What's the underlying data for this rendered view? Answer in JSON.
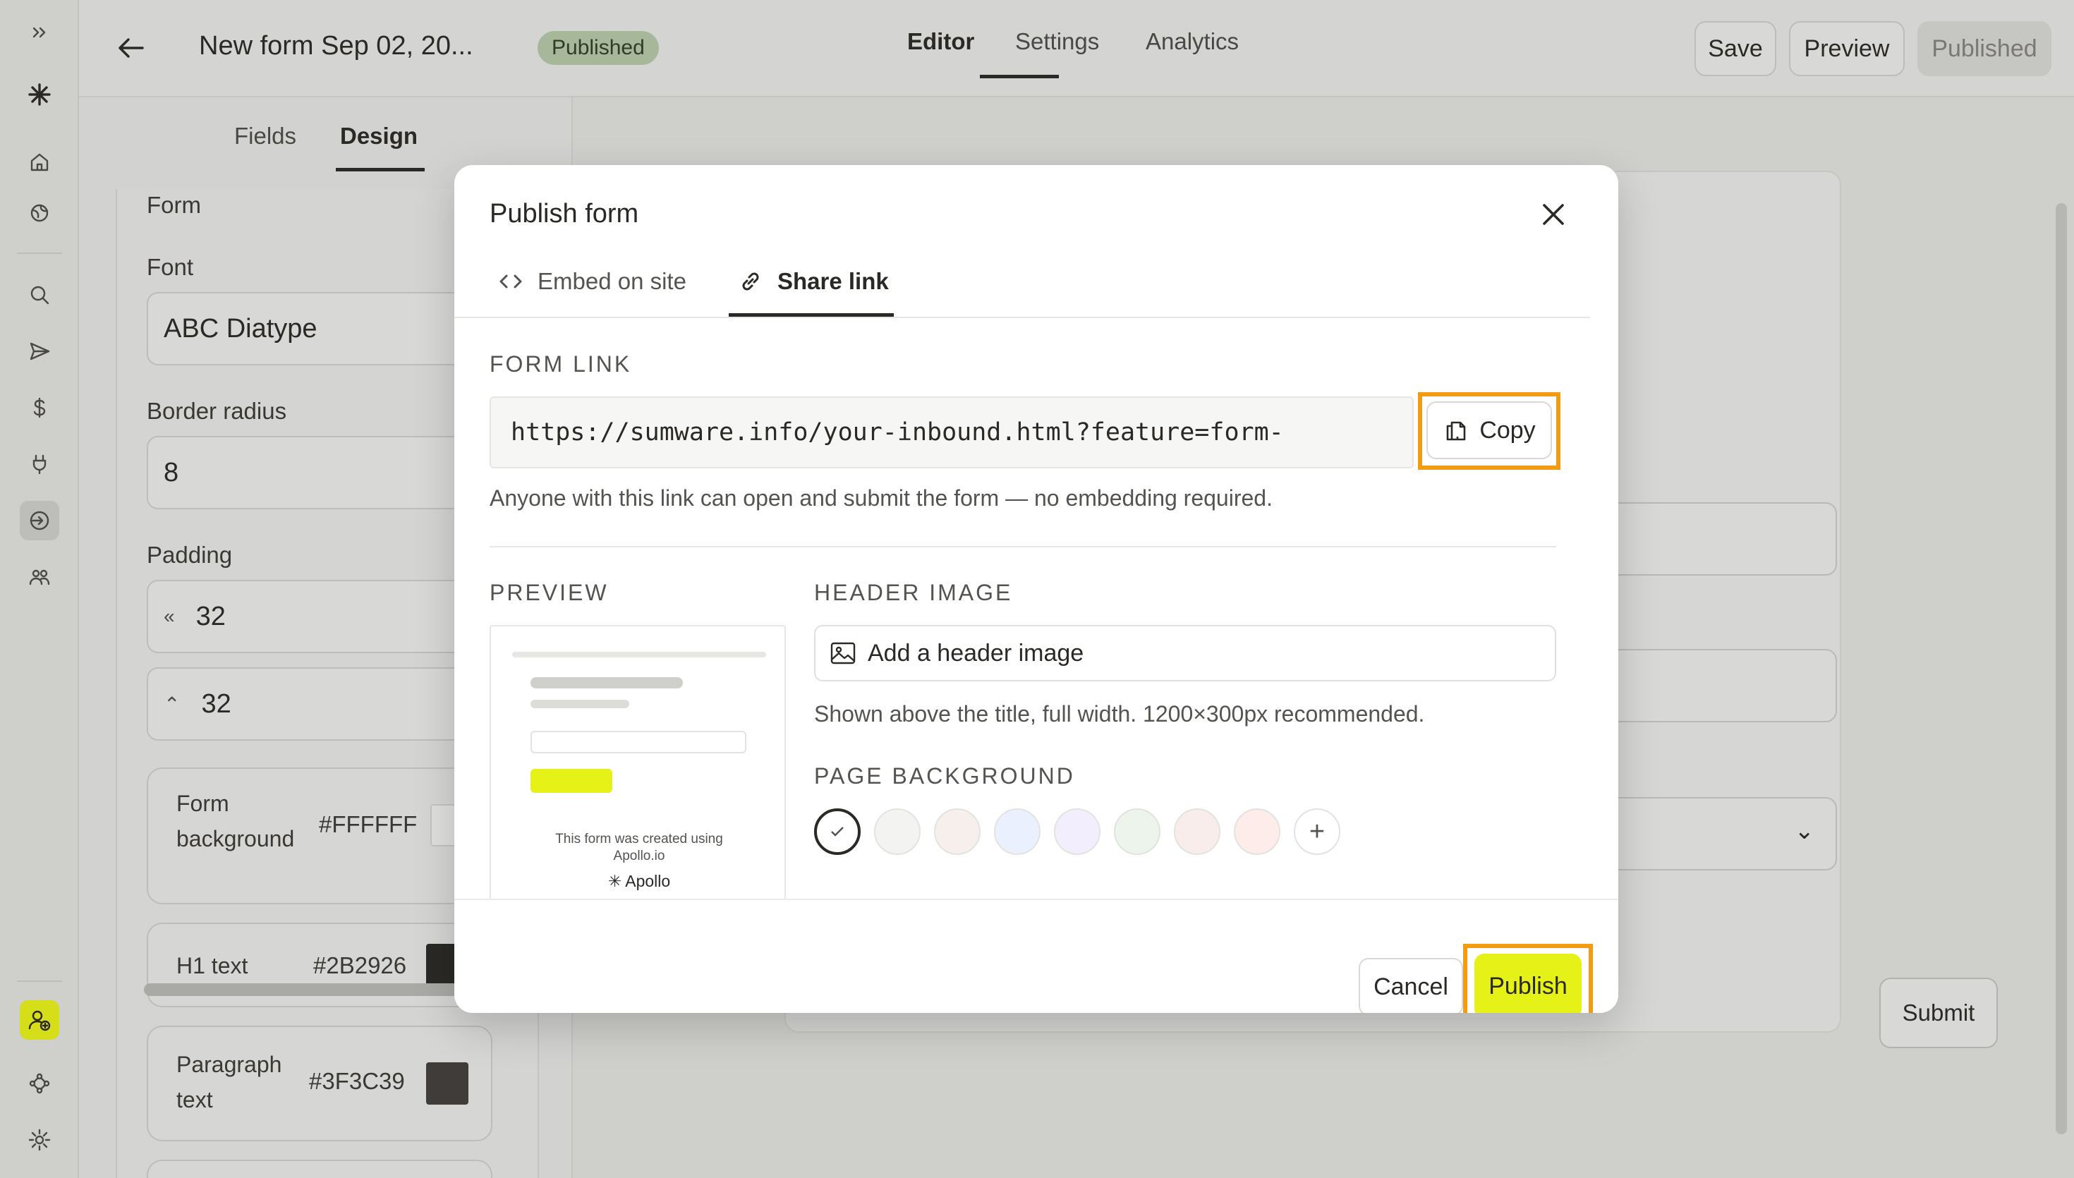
{
  "topbar": {
    "title": "New form Sep 02, 20...",
    "status": "Published",
    "tabs": [
      "Editor",
      "Settings",
      "Analytics"
    ],
    "active_tab": "Editor",
    "more": "•••",
    "save_label": "Save",
    "preview_label": "Preview",
    "published_label": "Published"
  },
  "rail": {
    "icons": [
      "expand-icon",
      "apollo-logo-icon",
      "home-icon",
      "globe-icon",
      "search-icon",
      "send-icon",
      "dollar-icon",
      "plug-icon",
      "inbound-icon",
      "people-icon",
      "add-user-icon",
      "workflow-icon",
      "gear-icon"
    ]
  },
  "panel": {
    "tabs": [
      "Fields",
      "Design"
    ],
    "active_tab": "Design",
    "section_form": "Form",
    "font_label": "Font",
    "font_value": "ABC Diatype",
    "border_radius_label": "Border radius",
    "border_radius_value": "8",
    "padding_label": "Padding",
    "padding_horizontal": "32",
    "padding_vertical": "32",
    "colors": [
      {
        "label_1": "Form",
        "label_2": "background",
        "hex": "#FFFFFF"
      },
      {
        "label_1": "H1 text",
        "label_2": "",
        "hex": "#2B2926"
      },
      {
        "label_1": "Paragraph",
        "label_2": "text",
        "hex": "#3F3C39"
      }
    ]
  },
  "canvas": {
    "submit_label": "Submit"
  },
  "modal": {
    "title": "Publish form",
    "tabs": [
      {
        "label": "Embed on site",
        "icon": "code-icon"
      },
      {
        "label": "Share link",
        "icon": "link-icon"
      }
    ],
    "active_tab": "Share link",
    "form_link_label": "FORM LINK",
    "form_link_value": "https://sumware.info/your-inbound.html?feature=form-",
    "copy_label": "Copy",
    "link_help": "Anyone with this link can open and submit the form — no embedding required.",
    "preview_label": "PREVIEW",
    "preview_note_1": "This form was created using",
    "preview_note_2": "Apollo.io",
    "preview_brand": "Apollo",
    "header_image_label": "HEADER IMAGE",
    "add_header_image": "Add a header image",
    "header_image_help": "Shown above the title, full width. 1200×300px recommended.",
    "page_background_label": "PAGE BACKGROUND",
    "background_swatches": [
      "#FFFFFF",
      "#F3F3F1",
      "#F6EFEC",
      "#EAF0FD",
      "#F3EEFD",
      "#ECF4EC",
      "#F8EDEA",
      "#FDECE9"
    ],
    "selected_swatch": 0,
    "cancel_label": "Cancel",
    "publish_label": "Publish",
    "accent_color": "#E6F217",
    "highlight_color": "#F39C12"
  }
}
